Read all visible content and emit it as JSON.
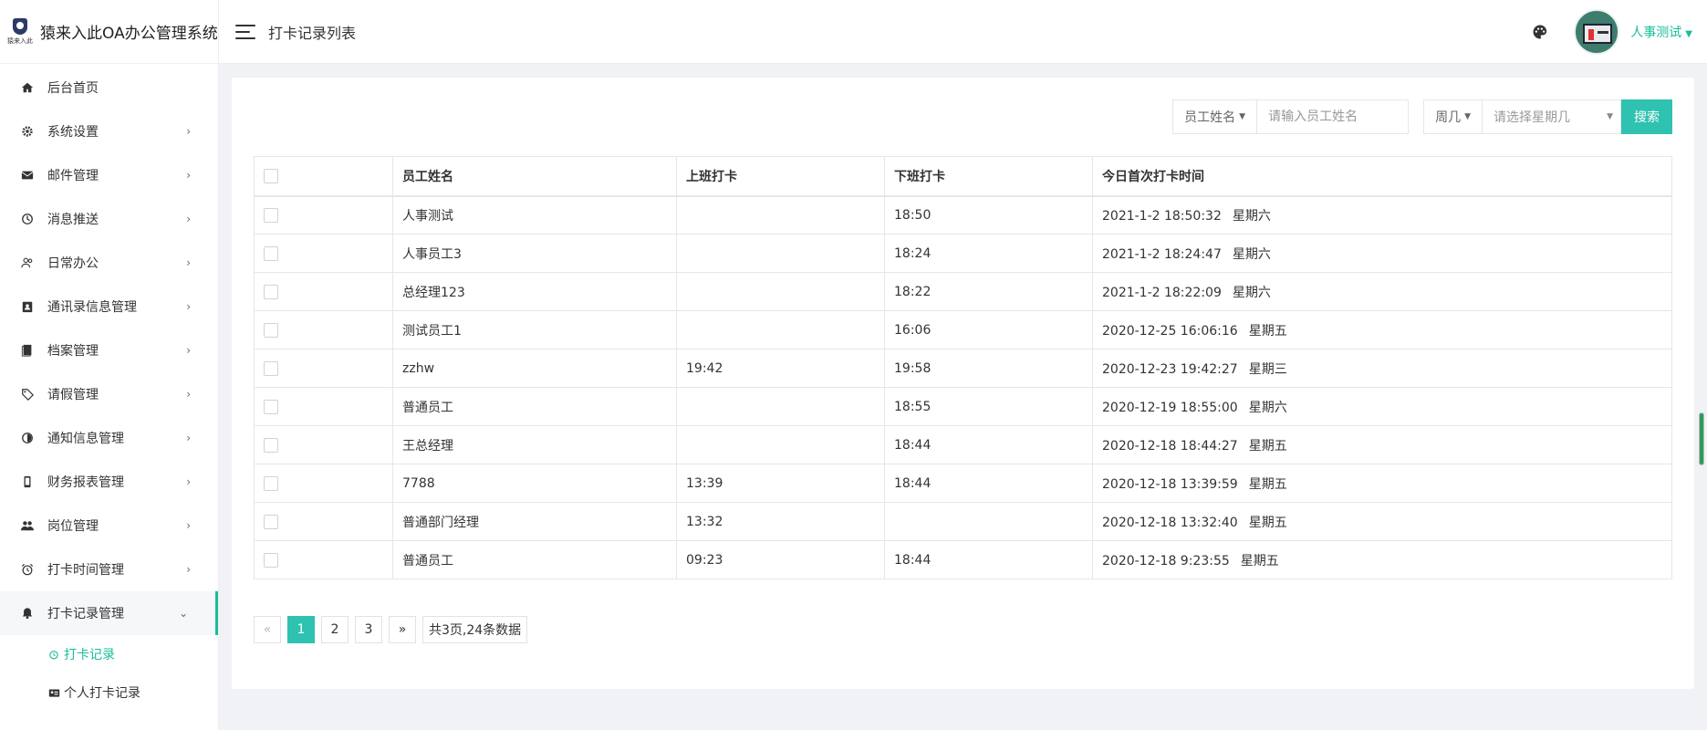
{
  "brand": {
    "title": "猿来入此OA办公管理系统",
    "logo_text": "猿来入此"
  },
  "sidebar": {
    "items": [
      {
        "label": "后台首页",
        "icon": "home-icon",
        "chevron": false
      },
      {
        "label": "系统设置",
        "icon": "gear-icon",
        "chevron": true
      },
      {
        "label": "邮件管理",
        "icon": "mail-icon",
        "chevron": true
      },
      {
        "label": "消息推送",
        "icon": "history-icon",
        "chevron": true
      },
      {
        "label": "日常办公",
        "icon": "users-icon",
        "chevron": true
      },
      {
        "label": "通讯录信息管理",
        "icon": "contact-badge-icon",
        "chevron": true
      },
      {
        "label": "档案管理",
        "icon": "file-icon",
        "chevron": true
      },
      {
        "label": "请假管理",
        "icon": "tag-icon",
        "chevron": true
      },
      {
        "label": "通知信息管理",
        "icon": "half-circle-icon",
        "chevron": true
      },
      {
        "label": "财务报表管理",
        "icon": "mobile-icon",
        "chevron": true
      },
      {
        "label": "岗位管理",
        "icon": "group-icon",
        "chevron": true
      },
      {
        "label": "打卡时间管理",
        "icon": "alarm-icon",
        "chevron": true
      },
      {
        "label": "打卡记录管理",
        "icon": "bell-icon",
        "chevron": true,
        "expanded": true
      }
    ],
    "subitems": [
      {
        "label": "打卡记录",
        "icon": "clock-icon",
        "active": true
      },
      {
        "label": "个人打卡记录",
        "icon": "id-card-icon",
        "active": false
      }
    ]
  },
  "header": {
    "title": "打卡记录列表",
    "user": "人事测试"
  },
  "search": {
    "name_label": "员工姓名",
    "name_placeholder": "请输入员工姓名",
    "week_label": "周几",
    "week_placeholder": "请选择星期几",
    "button": "搜索"
  },
  "table": {
    "headers": [
      "",
      "员工姓名",
      "上班打卡",
      "下班打卡",
      "今日首次打卡时间"
    ],
    "rows": [
      {
        "name": "人事测试",
        "in": "",
        "out": "18:50",
        "time": "2021-1-2 18:50:32",
        "weekday": "星期六"
      },
      {
        "name": "人事员工3",
        "in": "",
        "out": "18:24",
        "time": "2021-1-2 18:24:47",
        "weekday": "星期六"
      },
      {
        "name": "总经理123",
        "in": "",
        "out": "18:22",
        "time": "2021-1-2 18:22:09",
        "weekday": "星期六"
      },
      {
        "name": "测试员工1",
        "in": "",
        "out": "16:06",
        "time": "2020-12-25 16:06:16",
        "weekday": "星期五"
      },
      {
        "name": "zzhw",
        "in": "19:42",
        "out": "19:58",
        "time": "2020-12-23 19:42:27",
        "weekday": "星期三"
      },
      {
        "name": "普通员工",
        "in": "",
        "out": "18:55",
        "time": "2020-12-19 18:55:00",
        "weekday": "星期六"
      },
      {
        "name": "王总经理",
        "in": "",
        "out": "18:44",
        "time": "2020-12-18 18:44:27",
        "weekday": "星期五"
      },
      {
        "name": "7788",
        "in": "13:39",
        "out": "18:44",
        "time": "2020-12-18 13:39:59",
        "weekday": "星期五"
      },
      {
        "name": "普通部门经理",
        "in": "13:32",
        "out": "",
        "time": "2020-12-18 13:32:40",
        "weekday": "星期五"
      },
      {
        "name": "普通员工",
        "in": "09:23",
        "out": "18:44",
        "time": "2020-12-18 9:23:55",
        "weekday": "星期五"
      }
    ]
  },
  "pagination": {
    "prev": "«",
    "next": "»",
    "pages": [
      "1",
      "2",
      "3"
    ],
    "current": "1",
    "summary": "共3页,24条数据"
  },
  "colors": {
    "accent": "#2fc2b0",
    "active_text": "#1abc9c"
  }
}
